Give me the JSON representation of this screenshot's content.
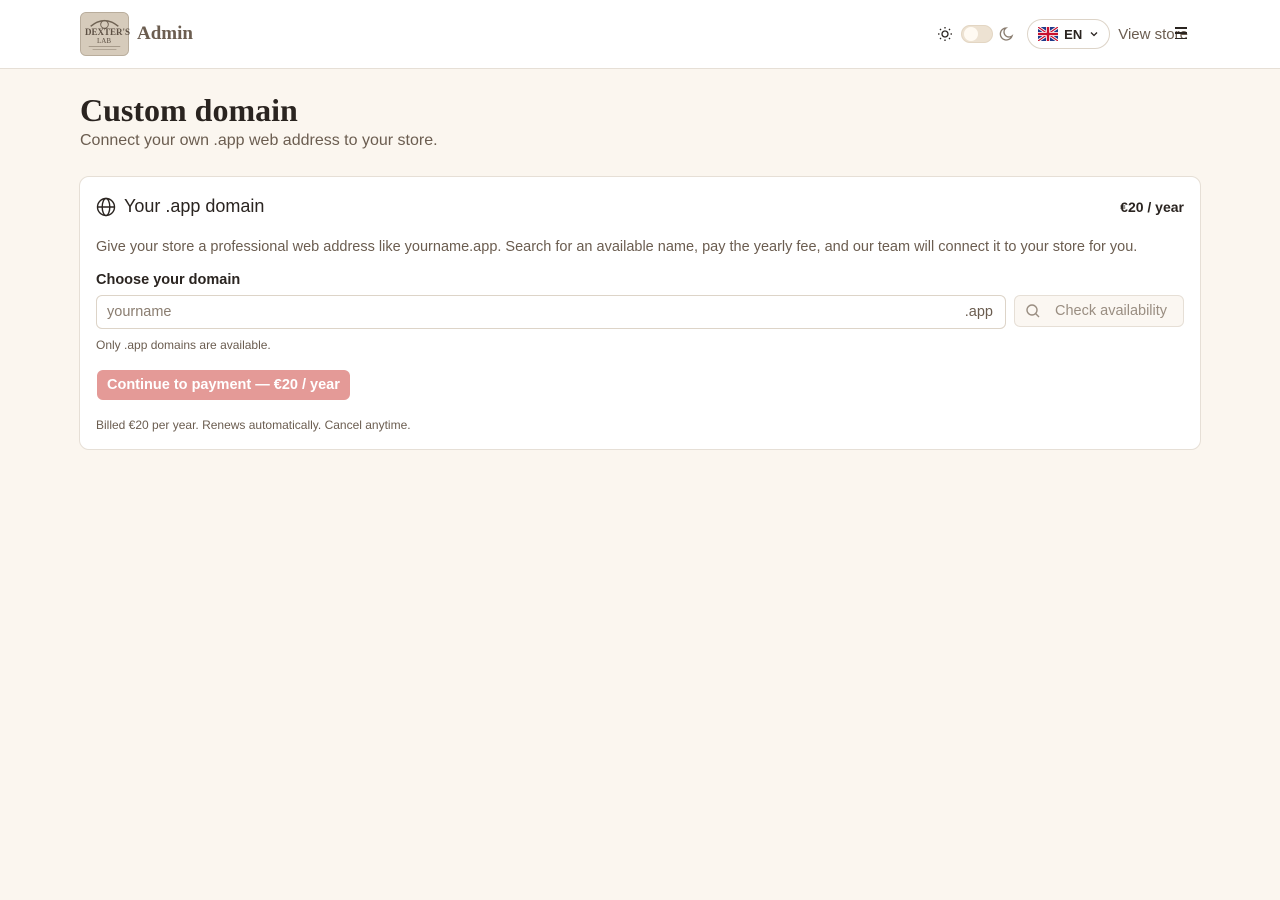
{
  "header": {
    "logo": {
      "lines": [
        "DEXTER'S",
        "LAB"
      ],
      "icon": "store-logo"
    },
    "brand_name": "Admin",
    "theme_toggle": {
      "left_icon": "sun-icon",
      "right_icon": "moon-icon",
      "state": "light"
    },
    "language": {
      "flag_icon": "uk-flag-icon",
      "code": "EN"
    },
    "view_store_label": "View store",
    "menu_icon": "hamburger-menu-icon"
  },
  "page": {
    "title": "Custom domain",
    "subtitle": "Connect your own .app web address to your store."
  },
  "card": {
    "icon": "globe-icon",
    "title": "Your .app domain",
    "price": "€20 / year",
    "description": "Give your store a professional web address like yourname.app. Search for an available name, pay the yearly fee, and our team will connect it to your store for you.",
    "field_label": "Choose your domain",
    "input": {
      "placeholder": "yourname",
      "value": "",
      "suffix": ".app"
    },
    "check_button": {
      "label": "Check availability",
      "icon": "search-icon"
    },
    "hint": "Only .app domains are available.",
    "pay_button": "Continue to payment — €20 / year",
    "billing_note": "Billed €20 per year. Renews automatically. Cancel anytime."
  },
  "colors": {
    "background": "#fbf6ef",
    "accent_disabled": "#e49a97",
    "text_primary": "#2a2420",
    "text_muted": "#6b5d50"
  }
}
